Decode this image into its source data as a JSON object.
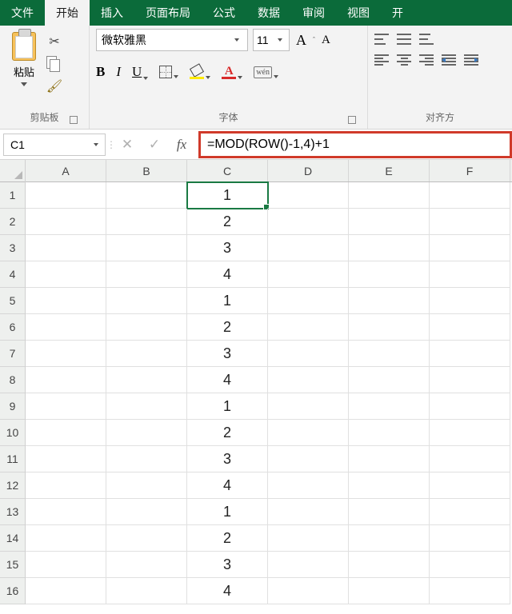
{
  "tabs": {
    "file": "文件",
    "home": "开始",
    "insert": "插入",
    "pagelayout": "页面布局",
    "formulas": "公式",
    "data": "数据",
    "review": "审阅",
    "view": "视图",
    "more": "开"
  },
  "ribbon": {
    "clipboard": {
      "paste": "粘贴",
      "label": "剪贴板"
    },
    "font": {
      "name": "微软雅黑",
      "size": "11",
      "grow": "A",
      "shrink": "A",
      "bold": "B",
      "italic": "I",
      "underline": "U",
      "wen": "wén",
      "fontcolor_letter": "A",
      "label": "字体"
    },
    "align": {
      "label": "对齐方"
    }
  },
  "namebox": "C1",
  "formula": "=MOD(ROW()-1,4)+1",
  "fx_cancel": "✕",
  "fx_confirm": "✓",
  "fx_label": "fx",
  "columns": [
    "A",
    "B",
    "C",
    "D",
    "E",
    "F"
  ],
  "rows": [
    "1",
    "2",
    "3",
    "4",
    "5",
    "6",
    "7",
    "8",
    "9",
    "10",
    "11",
    "12",
    "13",
    "14",
    "15",
    "16"
  ],
  "selected_cell": "C1",
  "cells": {
    "C1": "1",
    "C2": "2",
    "C3": "3",
    "C4": "4",
    "C5": "1",
    "C6": "2",
    "C7": "3",
    "C8": "4",
    "C9": "1",
    "C10": "2",
    "C11": "3",
    "C12": "4",
    "C13": "1",
    "C14": "2",
    "C15": "3",
    "C16": "4"
  }
}
